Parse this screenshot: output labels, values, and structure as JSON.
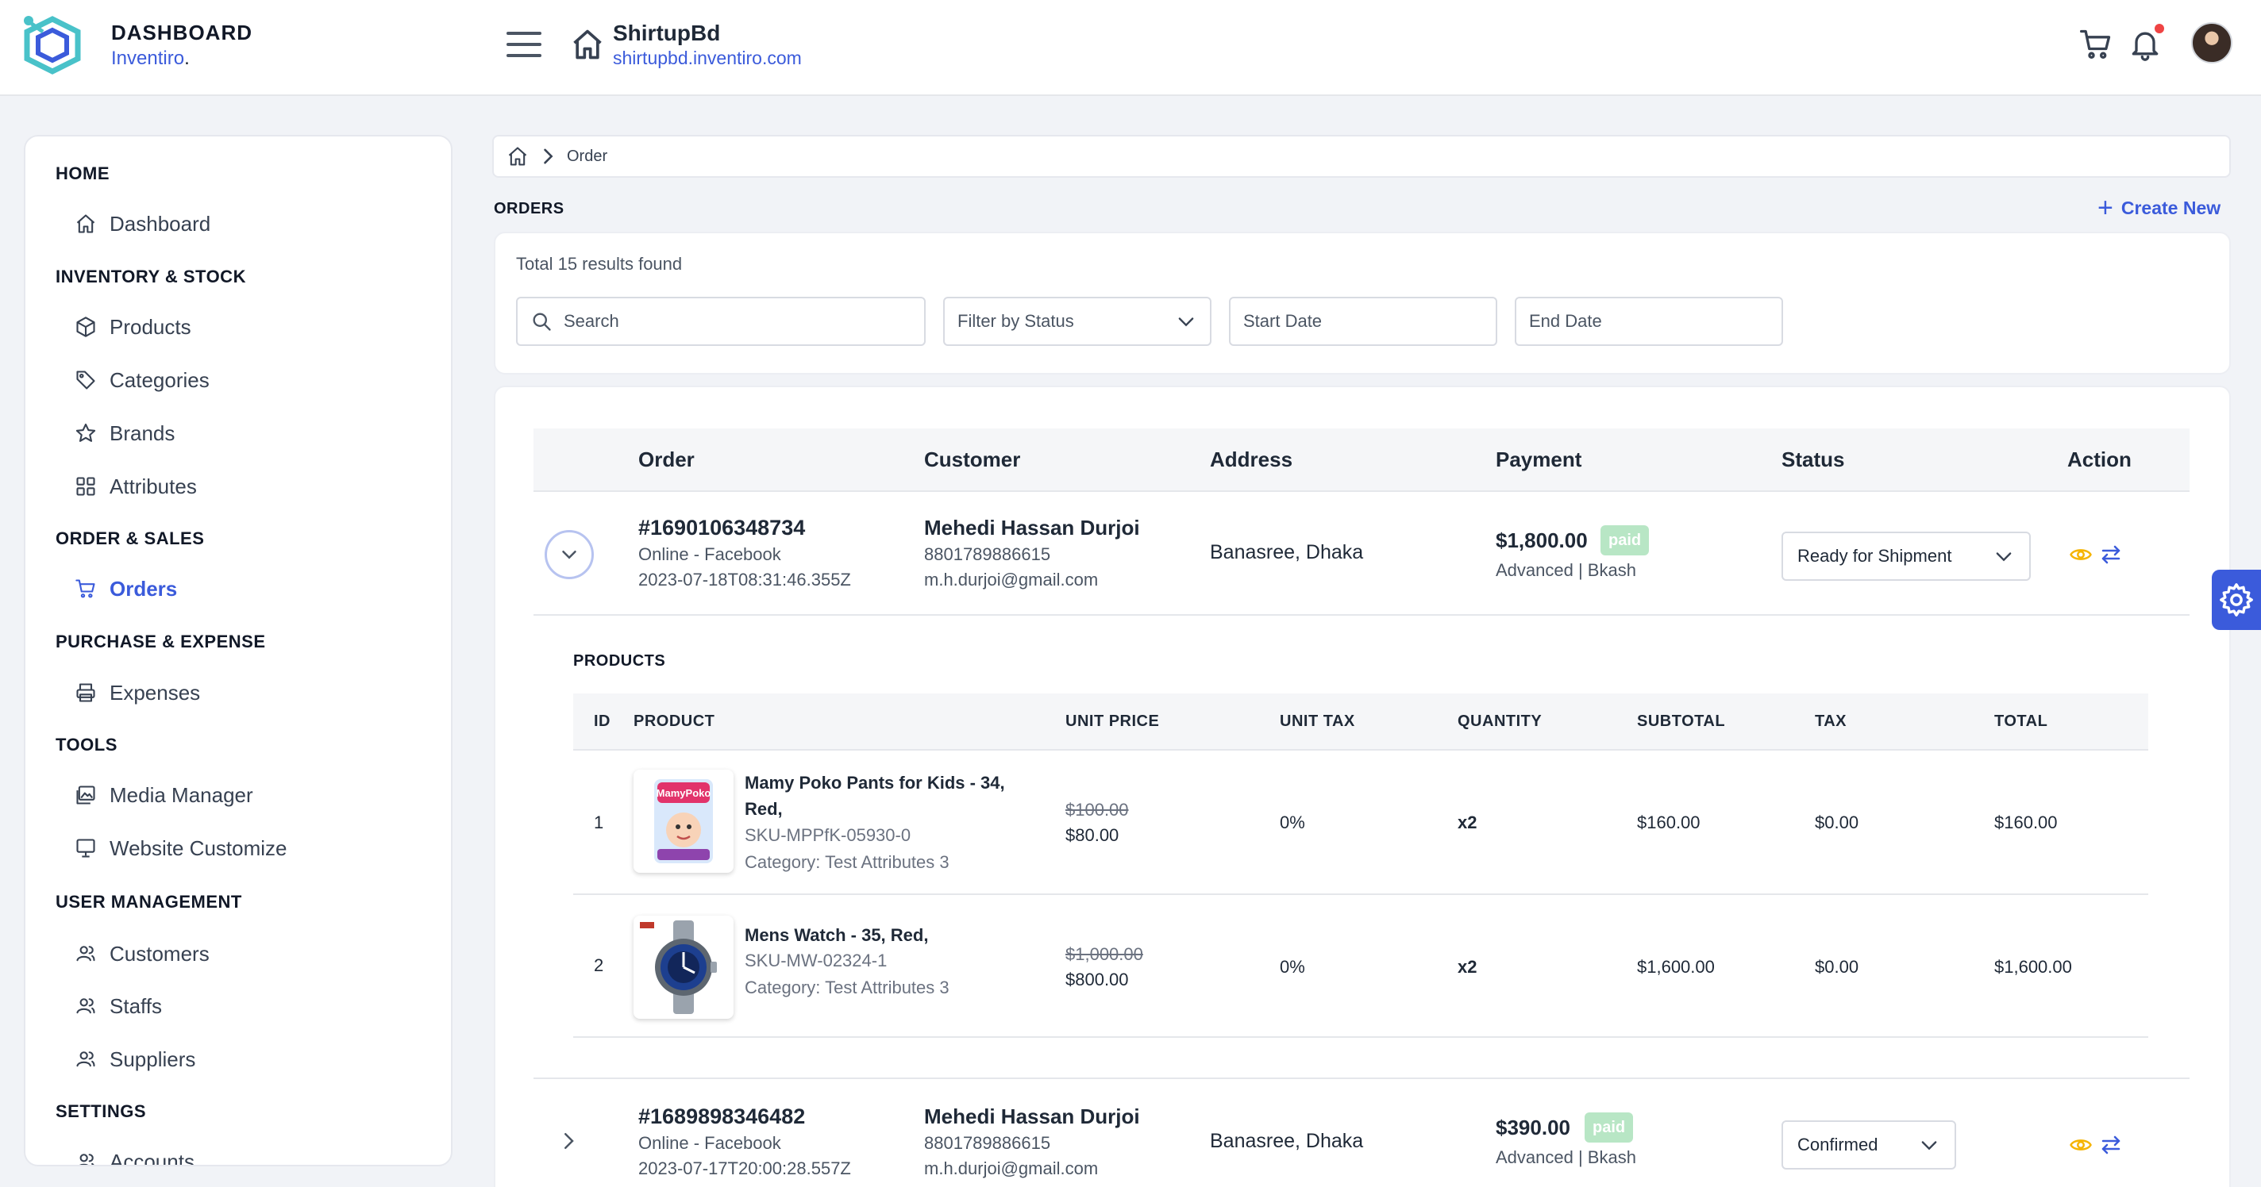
{
  "header": {
    "brand_title": "DASHBOARD",
    "brand_sub": "Inventiro",
    "brand_dot": ".",
    "store_name": "ShirtupBd",
    "store_url": "shirtupbd.inventiro.com"
  },
  "sidebar": {
    "sections": {
      "home": "HOME",
      "inventory": "INVENTORY & STOCK",
      "order": "ORDER & SALES",
      "purchase": "PURCHASE & EXPENSE",
      "tools": "TOOLS",
      "users": "USER MANAGEMENT",
      "settings": "SETTINGS"
    },
    "items": {
      "dashboard": "Dashboard",
      "products": "Products",
      "categories": "Categories",
      "brands": "Brands",
      "attributes": "Attributes",
      "orders": "Orders",
      "expenses": "Expenses",
      "media": "Media Manager",
      "website": "Website Customize",
      "customers": "Customers",
      "staffs": "Staffs",
      "suppliers": "Suppliers",
      "accounts": "Accounts"
    },
    "active_color": "#3b5bdb"
  },
  "breadcrumb": {
    "current": "Order"
  },
  "page": {
    "title": "ORDERS",
    "create_new": "Create New",
    "results": "Total 15 results found"
  },
  "filters": {
    "search_placeholder": "Search",
    "status_placeholder": "Filter by Status",
    "start_placeholder": "Start Date",
    "end_placeholder": "End Date"
  },
  "table": {
    "headers": {
      "order": "Order",
      "customer": "Customer",
      "address": "Address",
      "payment": "Payment",
      "status": "Status",
      "action": "Action"
    },
    "orders": [
      {
        "id": "#1690106348734",
        "channel": "Online - Facebook",
        "date": "2023-07-18T08:31:46.355Z",
        "customer": "Mehedi Hassan Durjoi",
        "phone": "8801789886615",
        "email": "m.h.durjoi@gmail.com",
        "address": "Banasree, Dhaka",
        "amount": "$1,800.00",
        "paid": "paid",
        "method": "Advanced | Bkash",
        "status": "Ready for Shipment"
      },
      {
        "id": "#1689898346482",
        "channel": "Online - Facebook",
        "date": "2023-07-17T20:00:28.557Z",
        "customer": "Mehedi Hassan Durjoi",
        "phone": "8801789886615",
        "email": "m.h.durjoi@gmail.com",
        "address": "Banasree, Dhaka",
        "amount": "$390.00",
        "paid": "paid",
        "method": "Advanced | Bkash",
        "status": "Confirmed"
      }
    ]
  },
  "products": {
    "label": "PRODUCTS",
    "headers": {
      "id": "ID",
      "product": "PRODUCT",
      "unit_price": "UNIT PRICE",
      "unit_tax": "UNIT TAX",
      "quantity": "QUANTITY",
      "subtotal": "SUBTOTAL",
      "tax": "TAX",
      "total": "TOTAL"
    },
    "rows": [
      {
        "id": "1",
        "name": "Mamy Poko Pants for Kids - 34, Red,",
        "sku": "SKU-MPPfK-05930-0",
        "category": "Category: Test Attributes 3",
        "old_price": "$100.00",
        "price": "$80.00",
        "unit_tax": "0%",
        "qty": "x2",
        "subtotal": "$160.00",
        "tax": "$0.00",
        "total": "$160.00"
      },
      {
        "id": "2",
        "name": "Mens Watch - 35, Red,",
        "sku": "SKU-MW-02324-1",
        "category": "Category: Test Attributes 3",
        "old_price": "$1,000.00",
        "price": "$800.00",
        "unit_tax": "0%",
        "qty": "x2",
        "subtotal": "$1,600.00",
        "tax": "$0.00",
        "total": "$1,600.00"
      }
    ]
  },
  "icons": {
    "logo": "inventiro-logo-icon",
    "menu": "hamburger-icon",
    "home": "home-icon",
    "cart": "cart-icon",
    "bell": "bell-icon",
    "eye": "eye-icon",
    "swap": "swap-icon",
    "gear": "gear-icon"
  },
  "colors": {
    "accent": "#3b5bdb",
    "paid_badge": "#b8e6c5",
    "eye": "#f5b400",
    "notification": "#ef4444"
  }
}
